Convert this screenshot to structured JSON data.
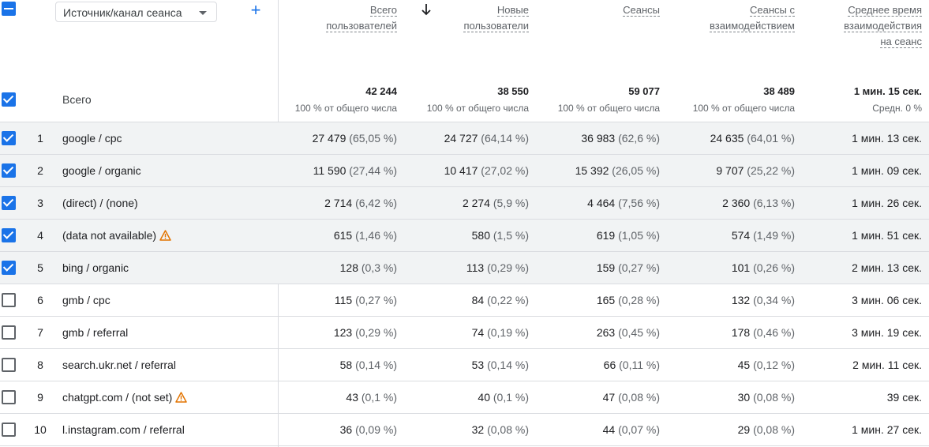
{
  "header": {
    "dimension_select": "Источник/канал сеанса",
    "add_dimension": "+",
    "metrics": [
      {
        "lines": [
          "Всего",
          "пользователей"
        ]
      },
      {
        "lines": [
          "Новые",
          "пользователи"
        ]
      },
      {
        "lines": [
          "Сеансы"
        ]
      },
      {
        "lines": [
          "Сеансы с",
          "взаимодействием"
        ]
      },
      {
        "lines": [
          "Среднее время",
          "взаимодействия",
          "на сеанс"
        ]
      }
    ]
  },
  "totals": {
    "label": "Всего",
    "values": [
      "42 244",
      "38 550",
      "59 077",
      "38 489",
      "1 мин. 15 сек."
    ],
    "subs": [
      "100 % от общего числа",
      "100 % от общего числа",
      "100 % от общего числа",
      "100 % от общего числа",
      "Средн. 0 %"
    ]
  },
  "rows": [
    {
      "idx": "1",
      "dim": "google / cpc",
      "checked": true,
      "warn": false,
      "vals": [
        [
          "27 479",
          "(65,05 %)"
        ],
        [
          "24 727",
          "(64,14 %)"
        ],
        [
          "36 983",
          "(62,6 %)"
        ],
        [
          "24 635",
          "(64,01 %)"
        ]
      ],
      "time": "1 мин. 13 сек."
    },
    {
      "idx": "2",
      "dim": "google / organic",
      "checked": true,
      "warn": false,
      "vals": [
        [
          "11 590",
          "(27,44 %)"
        ],
        [
          "10 417",
          "(27,02 %)"
        ],
        [
          "15 392",
          "(26,05 %)"
        ],
        [
          "9 707",
          "(25,22 %)"
        ]
      ],
      "time": "1 мин. 09 сек."
    },
    {
      "idx": "3",
      "dim": "(direct) / (none)",
      "checked": true,
      "warn": false,
      "vals": [
        [
          "2 714",
          "(6,42 %)"
        ],
        [
          "2 274",
          "(5,9 %)"
        ],
        [
          "4 464",
          "(7,56 %)"
        ],
        [
          "2 360",
          "(6,13 %)"
        ]
      ],
      "time": "1 мин. 26 сек."
    },
    {
      "idx": "4",
      "dim": "(data not available)",
      "checked": true,
      "warn": true,
      "vals": [
        [
          "615",
          "(1,46 %)"
        ],
        [
          "580",
          "(1,5 %)"
        ],
        [
          "619",
          "(1,05 %)"
        ],
        [
          "574",
          "(1,49 %)"
        ]
      ],
      "time": "1 мин. 51 сек."
    },
    {
      "idx": "5",
      "dim": "bing / organic",
      "checked": true,
      "warn": false,
      "vals": [
        [
          "128",
          "(0,3 %)"
        ],
        [
          "113",
          "(0,29 %)"
        ],
        [
          "159",
          "(0,27 %)"
        ],
        [
          "101",
          "(0,26 %)"
        ]
      ],
      "time": "2 мин. 13 сек."
    },
    {
      "idx": "6",
      "dim": "gmb / cpc",
      "checked": false,
      "warn": false,
      "vals": [
        [
          "115",
          "(0,27 %)"
        ],
        [
          "84",
          "(0,22 %)"
        ],
        [
          "165",
          "(0,28 %)"
        ],
        [
          "132",
          "(0,34 %)"
        ]
      ],
      "time": "3 мин. 06 сек."
    },
    {
      "idx": "7",
      "dim": "gmb / referral",
      "checked": false,
      "warn": false,
      "vals": [
        [
          "123",
          "(0,29 %)"
        ],
        [
          "74",
          "(0,19 %)"
        ],
        [
          "263",
          "(0,45 %)"
        ],
        [
          "178",
          "(0,46 %)"
        ]
      ],
      "time": "3 мин. 19 сек."
    },
    {
      "idx": "8",
      "dim": "search.ukr.net / referral",
      "checked": false,
      "warn": false,
      "vals": [
        [
          "58",
          "(0,14 %)"
        ],
        [
          "53",
          "(0,14 %)"
        ],
        [
          "66",
          "(0,11 %)"
        ],
        [
          "45",
          "(0,12 %)"
        ]
      ],
      "time": "2 мин. 11 сек."
    },
    {
      "idx": "9",
      "dim": "chatgpt.com / (not set)",
      "checked": false,
      "warn": true,
      "vals": [
        [
          "43",
          "(0,1 %)"
        ],
        [
          "40",
          "(0,1 %)"
        ],
        [
          "47",
          "(0,08 %)"
        ],
        [
          "30",
          "(0,08 %)"
        ]
      ],
      "time": "39 сек."
    },
    {
      "idx": "10",
      "dim": "l.instagram.com / referral",
      "checked": false,
      "warn": false,
      "vals": [
        [
          "36",
          "(0,09 %)"
        ],
        [
          "32",
          "(0,08 %)"
        ],
        [
          "44",
          "(0,07 %)"
        ],
        [
          "29",
          "(0,08 %)"
        ]
      ],
      "time": "1 мин. 27 сек."
    }
  ],
  "colors": {
    "accent": "#1a73e8",
    "warning": "#e37400",
    "row_highlight": "#f1f3f4"
  }
}
